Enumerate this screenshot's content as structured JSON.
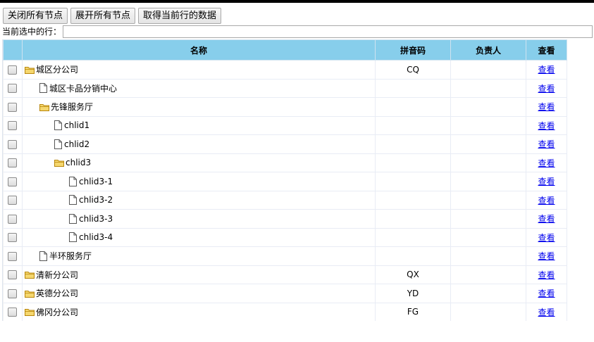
{
  "toolbar": {
    "collapse_all": "关闭所有节点",
    "expand_all": "展开所有节点",
    "get_current_row": "取得当前行的数据"
  },
  "current_row_label": "当前选中的行：",
  "current_row_value": "",
  "columns": {
    "name": "名称",
    "pinyin": "拼音码",
    "owner": "负责人",
    "view": "查看"
  },
  "rows": [
    {
      "name": "城区分公司",
      "pinyin": "CQ",
      "owner": "",
      "view": "查看",
      "level": 0,
      "icon": "folder-icon"
    },
    {
      "name": "城区卡品分销中心",
      "pinyin": "",
      "owner": "",
      "view": "查看",
      "level": 1,
      "icon": "file-icon"
    },
    {
      "name": "先锋服务厅",
      "pinyin": "",
      "owner": "",
      "view": "查看",
      "level": 1,
      "icon": "folder-icon"
    },
    {
      "name": "chlid1",
      "pinyin": "",
      "owner": "",
      "view": "查看",
      "level": 2,
      "icon": "file-icon"
    },
    {
      "name": "chlid2",
      "pinyin": "",
      "owner": "",
      "view": "查看",
      "level": 2,
      "icon": "file-icon"
    },
    {
      "name": "chlid3",
      "pinyin": "",
      "owner": "",
      "view": "查看",
      "level": 2,
      "icon": "folder-icon"
    },
    {
      "name": "chlid3-1",
      "pinyin": "",
      "owner": "",
      "view": "查看",
      "level": 3,
      "icon": "file-icon"
    },
    {
      "name": "chlid3-2",
      "pinyin": "",
      "owner": "",
      "view": "查看",
      "level": 3,
      "icon": "file-icon"
    },
    {
      "name": "chlid3-3",
      "pinyin": "",
      "owner": "",
      "view": "查看",
      "level": 3,
      "icon": "file-icon"
    },
    {
      "name": "chlid3-4",
      "pinyin": "",
      "owner": "",
      "view": "查看",
      "level": 3,
      "icon": "file-icon"
    },
    {
      "name": "半环服务厅",
      "pinyin": "",
      "owner": "",
      "view": "查看",
      "level": 1,
      "icon": "file-icon"
    },
    {
      "name": "清新分公司",
      "pinyin": "QX",
      "owner": "",
      "view": "查看",
      "level": 0,
      "icon": "folder-icon"
    },
    {
      "name": "英德分公司",
      "pinyin": "YD",
      "owner": "",
      "view": "查看",
      "level": 0,
      "icon": "folder-icon"
    },
    {
      "name": "佛冈分公司",
      "pinyin": "FG",
      "owner": "",
      "view": "查看",
      "level": 0,
      "icon": "folder-icon"
    }
  ],
  "colors": {
    "header_bg": "#87ceeb",
    "link": "#0000ee",
    "folder": "#f5d76e"
  }
}
